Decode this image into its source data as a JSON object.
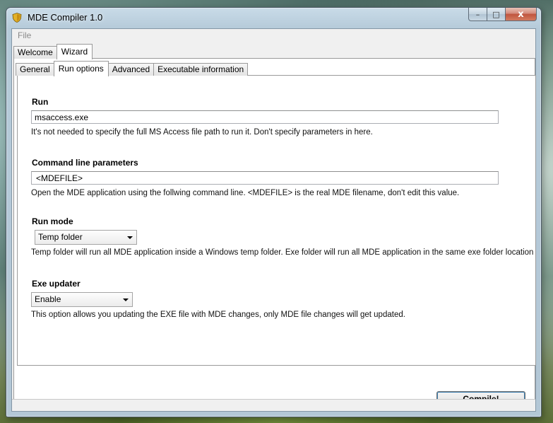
{
  "window": {
    "title": "MDE Compiler 1.0",
    "controls": {
      "minimize": "–",
      "maximize": "□",
      "close": "x"
    }
  },
  "menu": {
    "file": "File"
  },
  "outer_tabs": [
    {
      "label": "Welcome",
      "active": false
    },
    {
      "label": "Wizard",
      "active": true
    }
  ],
  "inner_tabs": [
    {
      "label": "General",
      "active": false
    },
    {
      "label": "Run options",
      "active": true
    },
    {
      "label": "Advanced",
      "active": false
    },
    {
      "label": "Executable information",
      "active": false
    }
  ],
  "run": {
    "title": "Run",
    "value": "msaccess.exe",
    "hint": "It's not needed to specify the full MS Access file path to run it. Don't specify parameters in here."
  },
  "cmdline": {
    "title": "Command line parameters",
    "value": "<MDEFILE>",
    "hint": "Open the MDE application using the follwing command line. <MDEFILE> is the real MDE filename, don't edit this value."
  },
  "run_mode": {
    "title": "Run mode",
    "selected": "Temp folder",
    "hint": "Temp folder will run all MDE application inside a Windows temp folder. Exe folder will run all MDE application in the same exe folder location"
  },
  "exe_updater": {
    "title": "Exe updater",
    "selected": "Enable",
    "hint": "This option allows you updating the EXE file with MDE changes, only MDE file changes will get updated."
  },
  "compile_label": "Compile!"
}
